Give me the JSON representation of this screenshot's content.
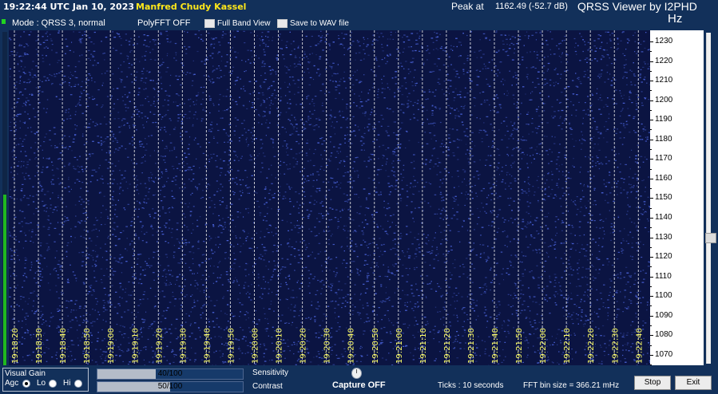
{
  "header": {
    "clock": "19:22:44 UTC  Jan 10, 2023",
    "station": "Manfred Chudy Kassel",
    "peak_label": "Peak at",
    "peak_value": "1162.49 (-52.7 dB)",
    "app_title": "QRSS Viewer by I2PHD",
    "units": "Hz"
  },
  "status": {
    "mode": "Mode : QRSS 3, normal",
    "polyfft": "PolyFFT OFF",
    "full_band_view": "Full Band View",
    "save_wav": "Save to WAV file"
  },
  "waterfall": {
    "time_labels": [
      "19:18:20",
      "19:18:30",
      "19:18:40",
      "19:18:50",
      "19:19:00",
      "19:19:10",
      "19:19:20",
      "19:19:30",
      "19:19:40",
      "19:19:50",
      "19:20:00",
      "19:20:10",
      "19:20:20",
      "19:20:30",
      "19:20:40",
      "19:20:50",
      "19:21:00",
      "19:21:10",
      "19:21:20",
      "19:21:30",
      "19:21:40",
      "19:21:50",
      "19:22:00",
      "19:22:10",
      "19:22:20",
      "19:22:30",
      "19:22:40"
    ],
    "frequency_labels": [
      "1230",
      "1220",
      "1210",
      "1200",
      "1190",
      "1180",
      "1170",
      "1160",
      "1150",
      "1140",
      "1130",
      "1120",
      "1110",
      "1100",
      "1090",
      "1080",
      "1070"
    ],
    "colors": {
      "background": "#0b1442",
      "noise": "#4a63d9",
      "gridline": "#e6e6e6"
    }
  },
  "controls": {
    "visual_gain": "Visual Gain",
    "agc": "Agc",
    "lo": "Lo",
    "hi": "Hi",
    "sensitivity_value": "40/100",
    "sensitivity_label": "Sensitivity",
    "sensitivity_level": 0.4,
    "contrast_value": "50/100",
    "contrast_label": "Contrast",
    "contrast_level": 0.5,
    "capture": "Capture OFF",
    "ticks": "Ticks   : 10 seconds",
    "fft_bin": "FFT bin size = 366.21 mHz",
    "stop": "Stop",
    "exit": "Exit"
  }
}
